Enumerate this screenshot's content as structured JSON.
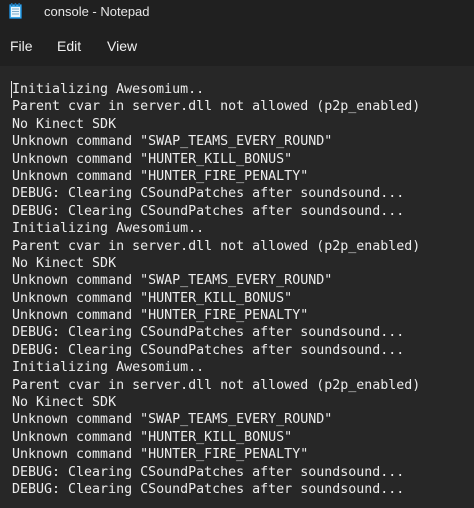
{
  "window": {
    "title": "console - Notepad",
    "icon": "notepad-icon"
  },
  "menu": {
    "items": [
      "File",
      "Edit",
      "View"
    ]
  },
  "colors": {
    "background": "#202020",
    "editor_background": "#272727",
    "text": "#ececec",
    "icon_accent": "#3fa9e8"
  },
  "editor": {
    "lines": [
      "Initializing Awesomium..",
      "Parent cvar in server.dll not allowed (p2p_enabled)",
      "No Kinect SDK",
      "Unknown command \"SWAP_TEAMS_EVERY_ROUND\"",
      "Unknown command \"HUNTER_KILL_BONUS\"",
      "Unknown command \"HUNTER_FIRE_PENALTY\"",
      "DEBUG: Clearing CSoundPatches after soundsound...",
      "DEBUG: Clearing CSoundPatches after soundsound...",
      "Initializing Awesomium..",
      "Parent cvar in server.dll not allowed (p2p_enabled)",
      "No Kinect SDK",
      "Unknown command \"SWAP_TEAMS_EVERY_ROUND\"",
      "Unknown command \"HUNTER_KILL_BONUS\"",
      "Unknown command \"HUNTER_FIRE_PENALTY\"",
      "DEBUG: Clearing CSoundPatches after soundsound...",
      "DEBUG: Clearing CSoundPatches after soundsound...",
      "Initializing Awesomium..",
      "Parent cvar in server.dll not allowed (p2p_enabled)",
      "No Kinect SDK",
      "Unknown command \"SWAP_TEAMS_EVERY_ROUND\"",
      "Unknown command \"HUNTER_KILL_BONUS\"",
      "Unknown command \"HUNTER_FIRE_PENALTY\"",
      "DEBUG: Clearing CSoundPatches after soundsound...",
      "DEBUG: Clearing CSoundPatches after soundsound..."
    ]
  }
}
